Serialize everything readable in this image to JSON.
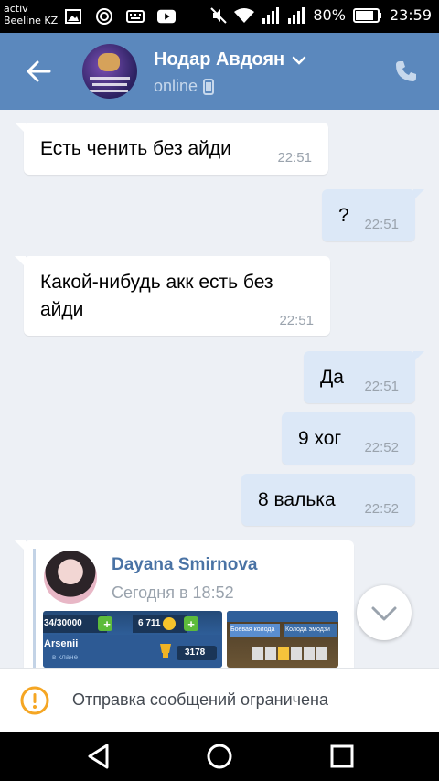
{
  "status_bar": {
    "carrier_line1": "activ",
    "carrier_line2": "Beeline KZ",
    "battery": "80%",
    "time": "23:59"
  },
  "header": {
    "contact_name": "Нодар Авдоян",
    "status": "online"
  },
  "messages": [
    {
      "direction": "in",
      "text": "Есть ченить без айди",
      "time": "22:51"
    },
    {
      "direction": "out",
      "text": "?",
      "time": "22:51"
    },
    {
      "direction": "in",
      "text_line1": "Какой-нибудь акк есть без",
      "text_line2": "айди",
      "time": "22:51"
    },
    {
      "direction": "out",
      "text": "Да",
      "time": "22:51"
    },
    {
      "direction": "out",
      "text": "9 хог",
      "time": "22:52"
    },
    {
      "direction": "out",
      "text": "8 валька",
      "time": "22:52"
    }
  ],
  "forwarded": {
    "author": "Dayana Smirnova",
    "date": "Сегодня в 18:52",
    "shot1": {
      "counter": "34/30000",
      "gold": "6 711",
      "player": "Arsenii",
      "clan": "в клане",
      "trophies": "3178"
    },
    "shot2": {
      "tab1": "Боевая колода",
      "tab2": "Колода эмодзи"
    }
  },
  "restriction": {
    "text": "Отправка сообщений ограничена"
  },
  "colors": {
    "header_bg": "#5b88bd",
    "outgoing_bubble": "#dce8f7",
    "incoming_bubble": "#ffffff",
    "warning": "#f5a623"
  },
  "icons": [
    "back-arrow-icon",
    "chevron-down-icon",
    "mobile-icon",
    "phone-icon",
    "scroll-down-icon",
    "warning-icon",
    "nav-back-icon",
    "nav-home-icon",
    "nav-recents-icon"
  ]
}
